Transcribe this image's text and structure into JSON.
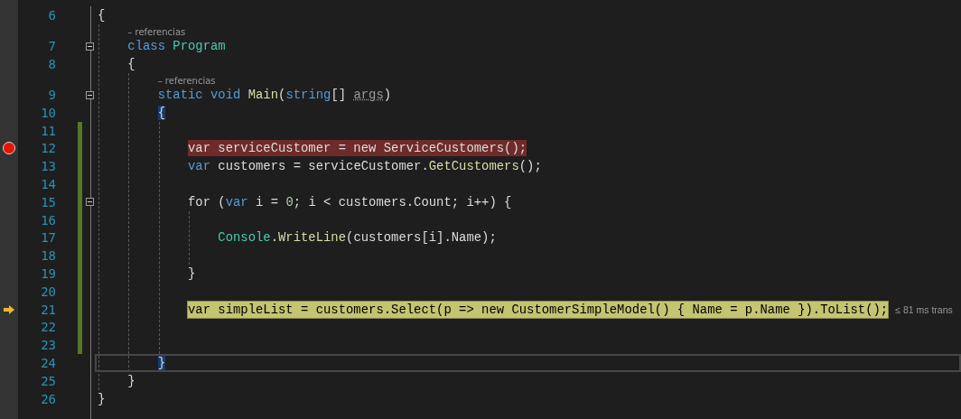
{
  "editor": {
    "lines": [
      {
        "number": "6",
        "tokens": [
          {
            "text": "{",
            "kind": "plain"
          }
        ],
        "children": [
          {
            "number": "7",
            "lens": "– referencias",
            "foldable": true,
            "tokens": [
              {
                "text": "class",
                "kind": "keyword"
              },
              {
                "text": " Program",
                "kind": "type"
              }
            ]
          },
          {
            "number": "8",
            "tokens": [
              {
                "text": "{",
                "kind": "plain"
              }
            ],
            "children": [
              {
                "number": "9",
                "lens": "– referencias",
                "foldable": true,
                "tokens": [
                  {
                    "text": "static void",
                    "kind": "keyword"
                  },
                  {
                    "text": " Main",
                    "kind": "method"
                  },
                  {
                    "text": "(",
                    "kind": "plain"
                  },
                  {
                    "text": "string",
                    "kind": "keyword"
                  },
                  {
                    "text": "[] ",
                    "kind": "plain"
                  },
                  {
                    "text": "args",
                    "kind": "unused"
                  },
                  {
                    "text": ")",
                    "kind": "plain"
                  }
                ]
              },
              {
                "number": "10",
                "tokens": [
                  {
                    "text": "{",
                    "kind": "brace_match"
                  }
                ],
                "children": [
                  {
                    "number": "11",
                    "changed": true
                  },
                  {
                    "number": "12",
                    "changed": true,
                    "breakpoint": true,
                    "tokens": [
                      {
                        "text": "var serviceCustomer = new ServiceCustomers();",
                        "kind": "plain"
                      }
                    ]
                  },
                  {
                    "number": "13",
                    "changed": true,
                    "tokens": [
                      {
                        "text": "var",
                        "kind": "keyword"
                      },
                      {
                        "text": " customers = serviceCustomer.",
                        "kind": "plain"
                      },
                      {
                        "text": "GetCustomers",
                        "kind": "method"
                      },
                      {
                        "text": "();",
                        "kind": "plain"
                      }
                    ]
                  },
                  {
                    "number": "14",
                    "changed": true
                  },
                  {
                    "number": "15",
                    "changed": true,
                    "foldable": true,
                    "tokens": [
                      {
                        "text": "for",
                        "kind": "plain"
                      },
                      {
                        "text": " (",
                        "kind": "plain"
                      },
                      {
                        "text": "var",
                        "kind": "keyword"
                      },
                      {
                        "text": " i = ",
                        "kind": "plain"
                      },
                      {
                        "text": "0",
                        "kind": "number"
                      },
                      {
                        "text": "; i < customers.Count; i++) {",
                        "kind": "plain"
                      }
                    ],
                    "children": [
                      {
                        "number": "16",
                        "changed": true
                      },
                      {
                        "number": "17",
                        "changed": true,
                        "tokens": [
                          {
                            "text": "Console",
                            "kind": "type"
                          },
                          {
                            "text": ".",
                            "kind": "plain"
                          },
                          {
                            "text": "WriteLine",
                            "kind": "method"
                          },
                          {
                            "text": "(customers[i].Name);",
                            "kind": "plain"
                          }
                        ]
                      },
                      {
                        "number": "18",
                        "changed": true
                      }
                    ]
                  },
                  {
                    "number": "19",
                    "changed": true,
                    "tokens": [
                      {
                        "text": "}",
                        "kind": "plain"
                      }
                    ]
                  },
                  {
                    "number": "20",
                    "changed": true
                  },
                  {
                    "number": "21",
                    "changed": true,
                    "current_statement": true,
                    "tip": "≤ 81 ms trans",
                    "tokens": [
                      {
                        "text": "var simpleList = customers.Select(p => new CustomerSimpleModel() { Name = p.Name }).ToList();",
                        "kind": "plain"
                      }
                    ]
                  },
                  {
                    "number": "22",
                    "changed": true
                  },
                  {
                    "number": "23",
                    "changed": true
                  }
                ]
              },
              {
                "number": "24",
                "caret_line": true,
                "tokens": [
                  {
                    "text": "}",
                    "kind": "brace_match"
                  }
                ]
              }
            ]
          },
          {
            "number": "25",
            "tokens": [
              {
                "text": "}",
                "kind": "plain"
              }
            ]
          }
        ]
      },
      {
        "number": "26",
        "tokens": [
          {
            "text": "}",
            "kind": "plain"
          }
        ]
      }
    ]
  }
}
